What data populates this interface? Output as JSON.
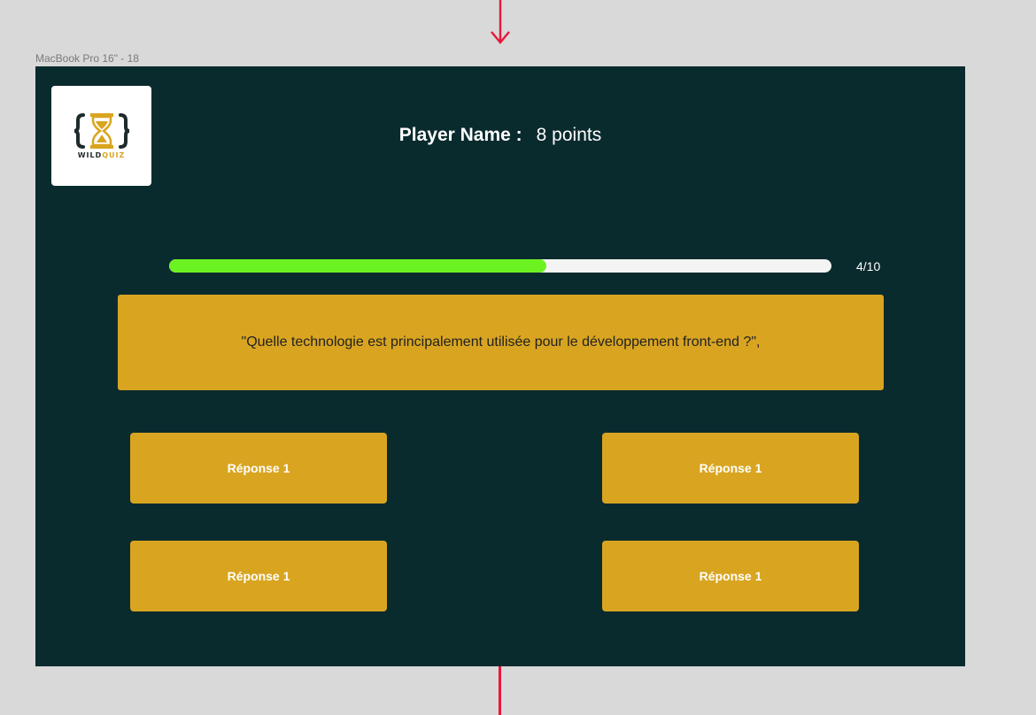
{
  "frame": {
    "label": "MacBook Pro 16\" - 18"
  },
  "logo": {
    "text_main": "WILD",
    "text_accent": "QUIZ",
    "icon": "hourglass-braces-icon"
  },
  "header": {
    "player_label": "Player Name :",
    "score": "8 points"
  },
  "progress": {
    "label": "4/10",
    "fraction": 0.57
  },
  "question": {
    "text": "\"Quelle technologie est principalement utilisée pour le développement front-end ?\","
  },
  "answers": [
    {
      "label": "Réponse 1"
    },
    {
      "label": "Réponse 1"
    },
    {
      "label": "Réponse 1"
    },
    {
      "label": "Réponse 1"
    }
  ],
  "colors": {
    "background": "#0a2b2e",
    "accent": "#d9a520",
    "progress": "#6df221",
    "connector": "#e8173a"
  }
}
